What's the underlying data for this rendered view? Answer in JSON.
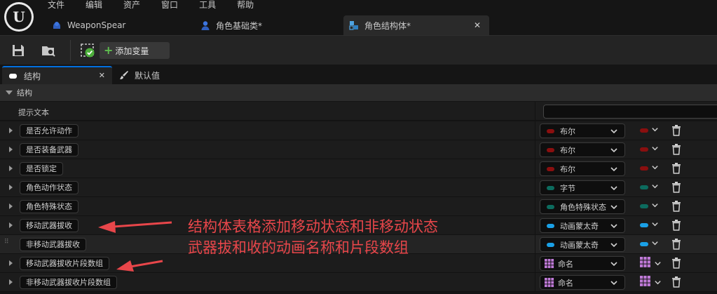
{
  "menu": [
    "文件",
    "编辑",
    "资产",
    "窗口",
    "工具",
    "帮助"
  ],
  "doc_tabs": [
    {
      "label": "WeaponSpear",
      "icon": "blueprint-icon",
      "active": false
    },
    {
      "label": "角色基础类*",
      "icon": "character-icon",
      "active": false
    },
    {
      "label": "角色结构体*",
      "icon": "struct-icon",
      "active": true
    }
  ],
  "toolbar": {
    "add_variable_label": "添加变量"
  },
  "panel_tabs": [
    {
      "label": "结构",
      "icon": "struct-icon",
      "active": true
    },
    {
      "label": "默认值",
      "icon": "brush-icon",
      "active": false
    }
  ],
  "section": {
    "title": "结构"
  },
  "tooltip_row": {
    "label": "提示文本",
    "value": ""
  },
  "members": [
    {
      "name": "是否允许动作",
      "type": "布尔",
      "color": "#8a0f0f",
      "kind": "pill",
      "container_color": "#8a0f0f"
    },
    {
      "name": "是否装备武器",
      "type": "布尔",
      "color": "#8a0f0f",
      "kind": "pill",
      "container_color": "#8a0f0f"
    },
    {
      "name": "是否锁定",
      "type": "布尔",
      "color": "#8a0f0f",
      "kind": "pill",
      "container_color": "#8a0f0f"
    },
    {
      "name": "角色动作状态",
      "type": "字节",
      "color": "#0c6b5e",
      "kind": "pill",
      "container_color": "#0c6b5e"
    },
    {
      "name": "角色特殊状态",
      "type": "角色特殊状态",
      "color": "#0c6b5e",
      "kind": "pill",
      "container_color": "#0c6b5e"
    },
    {
      "name": "移动武器拔收",
      "type": "动画蒙太奇",
      "color": "#1aa0e6",
      "kind": "pill",
      "container_color": "#1aa0e6"
    },
    {
      "name": "非移动武器拔收",
      "type": "动画蒙太奇",
      "color": "#1aa0e6",
      "kind": "pill",
      "container_color": "#1aa0e6"
    },
    {
      "name": "移动武器拔收片段数组",
      "type": "命名",
      "color": "#c07ad8",
      "kind": "array",
      "container_color": "#c07ad8"
    },
    {
      "name": "非移动武器拔收片段数组",
      "type": "命名",
      "color": "#c07ad8",
      "kind": "array",
      "container_color": "#c07ad8"
    }
  ],
  "annotation": {
    "line1": "结构体表格添加移动状态和非移动状态",
    "line2": "武器拔和收的动画名称和片段数组",
    "color": "#e8464a"
  }
}
